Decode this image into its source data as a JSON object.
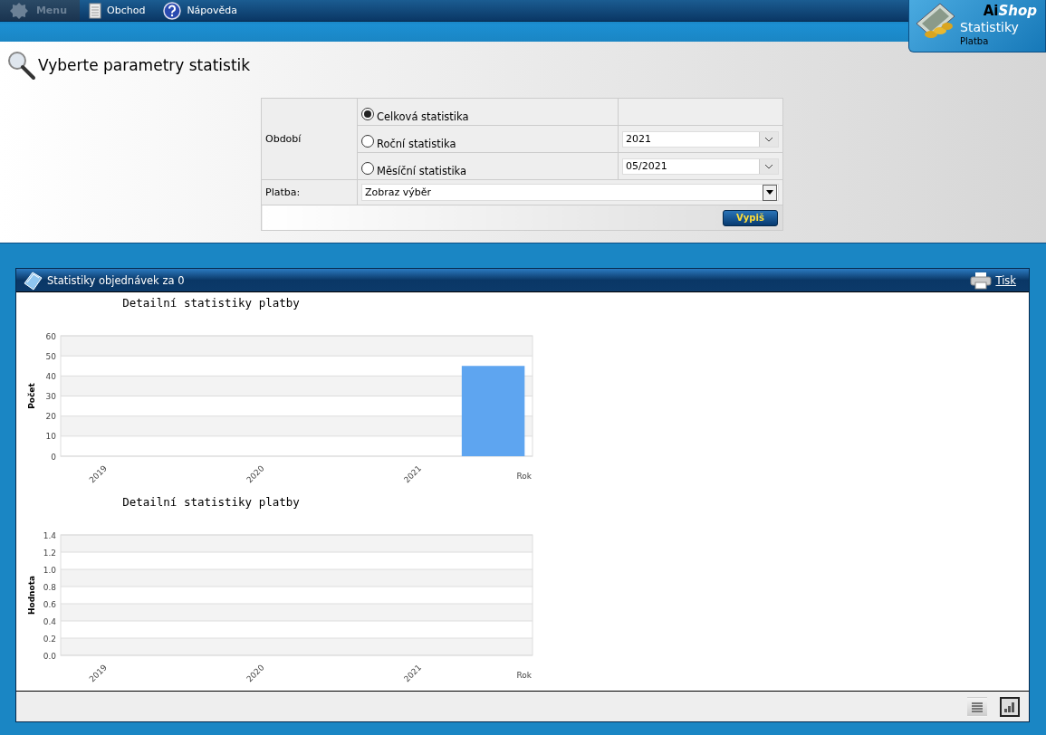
{
  "menu": [
    {
      "label": "Menu",
      "kind": "menu",
      "disabled": true
    },
    {
      "label": "Obchod",
      "kind": "page",
      "disabled": false
    },
    {
      "label": "Nápověda",
      "kind": "help",
      "disabled": false
    }
  ],
  "brand": {
    "name_part_1": "Ai",
    "name_part_2": "Shop",
    "section": "Statistiky",
    "subsection": "Platba"
  },
  "heading": "Vyberte parametry statistik",
  "form": {
    "period_label": "Období",
    "periods": [
      {
        "label": "Celková statistika",
        "selected": true
      },
      {
        "label": "Roční statistika",
        "selected": false,
        "value": "2021"
      },
      {
        "label": "Měsíční statistika",
        "selected": false,
        "value": "05/2021"
      }
    ],
    "payment_label": "Platba:",
    "payment_value": "Zobraz výběr",
    "submit": "Vypiš"
  },
  "panel": {
    "title": "Statistiky objednávek za 0",
    "print": "Tisk",
    "charts": [
      {
        "chart_data": {
          "type": "bar",
          "title": "Detailní statistiky platby",
          "xlabel": "Rok",
          "ylabel": "Počet",
          "categories": [
            "2019",
            "2020",
            "2021"
          ],
          "grid": true,
          "series": [
            {
              "color": "#5ea5f0",
              "values": [
                0,
                0,
                45
              ]
            }
          ],
          "ylim": [
            0,
            60
          ],
          "yticks": [
            {
              "value": 0,
              "label": "0"
            },
            {
              "value": 10,
              "label": "10"
            },
            {
              "value": 20,
              "label": "20"
            },
            {
              "value": 30,
              "label": "30"
            },
            {
              "value": 40,
              "label": "40"
            },
            {
              "value": 50,
              "label": "50"
            },
            {
              "value": 60,
              "label": "60"
            }
          ]
        }
      },
      {
        "chart_data": {
          "type": "bar",
          "title": "Detailní statistiky platby",
          "xlabel": "Rok",
          "ylabel": "Hodnota",
          "categories": [
            "2019",
            "2020",
            "2021"
          ],
          "grid": true,
          "series": [
            {
              "values": [
                0,
                0,
                0
              ]
            }
          ],
          "ylim": [
            0,
            1.4
          ],
          "yticks": [
            {
              "value": 0,
              "label": "0.0"
            },
            {
              "value": 0.2,
              "label": "0.2"
            },
            {
              "value": 0.4,
              "label": "0.4"
            },
            {
              "value": 0.6,
              "label": "0.6"
            },
            {
              "value": 0.8,
              "label": "0.8"
            },
            {
              "value": 1.0,
              "label": "1.0"
            },
            {
              "value": 1.2,
              "label": "1.2"
            },
            {
              "value": 1.4,
              "label": "1.4"
            }
          ]
        }
      }
    ],
    "views": [
      {
        "kind": "list",
        "selected": false
      },
      {
        "kind": "chart",
        "selected": true
      }
    ]
  }
}
